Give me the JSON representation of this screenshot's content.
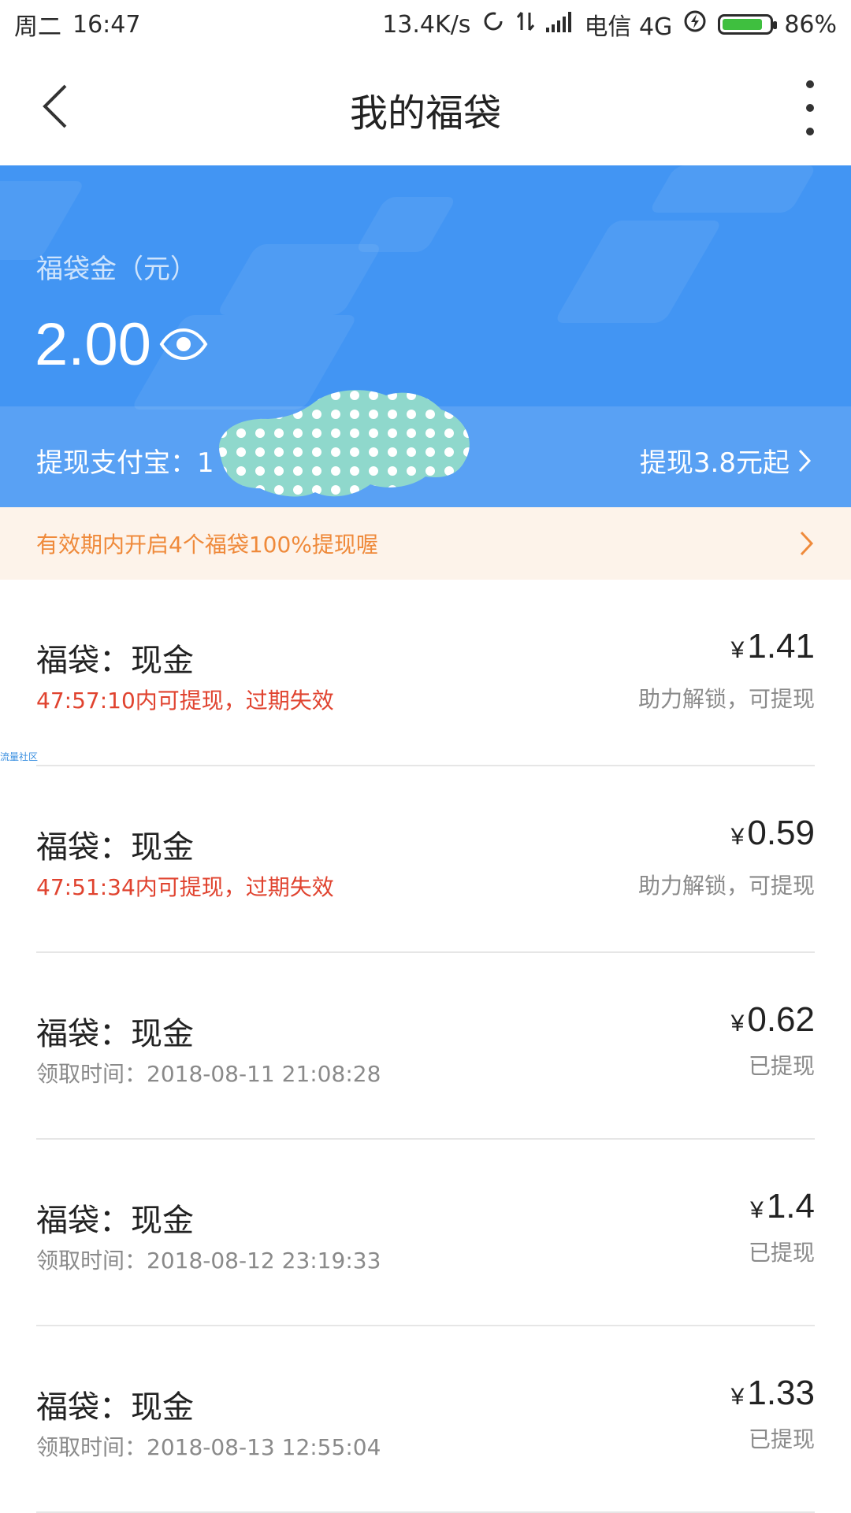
{
  "status_bar": {
    "day": "周二",
    "time": "16:47",
    "speed": "13.4K/s",
    "carrier": "电信 4G",
    "battery": "86%",
    "battery_level": 0.86
  },
  "nav": {
    "title": "我的福袋"
  },
  "hero": {
    "label": "福袋金（元）",
    "amount": "2.00",
    "account_prefix": "提现支付宝：1",
    "withdraw_text": "提现3.8元起"
  },
  "banner": {
    "text": "有效期内开启4个福袋100%提现喔"
  },
  "watermark": "流量社区",
  "items": [
    {
      "title": "福袋：现金",
      "sub": "47:57:10内可提现，过期失效",
      "sub_type": "red",
      "amount": "1.41",
      "status": "助力解锁，可提现"
    },
    {
      "title": "福袋：现金",
      "sub": "47:51:34内可提现，过期失效",
      "sub_type": "red",
      "amount": "0.59",
      "status": "助力解锁，可提现"
    },
    {
      "title": "福袋：现金",
      "sub": "领取时间：2018-08-11 21:08:28",
      "sub_type": "grey",
      "amount": "0.62",
      "status": "已提现"
    },
    {
      "title": "福袋：现金",
      "sub": "领取时间：2018-08-12 23:19:33",
      "sub_type": "grey",
      "amount": "1.4",
      "status": "已提现"
    },
    {
      "title": "福袋：现金",
      "sub": "领取时间：2018-08-13 12:55:04",
      "sub_type": "grey",
      "amount": "1.33",
      "status": "已提现"
    }
  ],
  "currency_symbol": "¥",
  "colors": {
    "hero_blue": "#4295f3",
    "banner_bg": "#fdf3ea",
    "banner_text": "#ef8a3b",
    "expire_red": "#e0432f"
  }
}
